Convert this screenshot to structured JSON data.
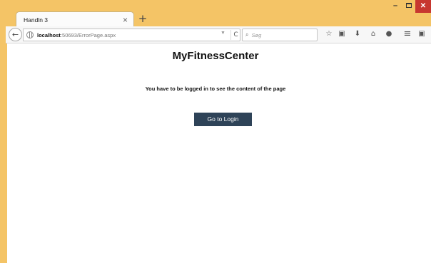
{
  "tab": {
    "title": "Handln 3",
    "close_glyph": "×",
    "new_tab_glyph": "+"
  },
  "window": {
    "minimize_glyph": "–",
    "close_glyph": "✕"
  },
  "toolbar": {
    "back_glyph": "←",
    "url_host": "localhost",
    "url_rest": ":50693/ErrorPage.aspx",
    "url_dropdown_glyph": "▼",
    "reload_glyph": "C",
    "search_placeholder": "Søg",
    "search_glyph": "⌕",
    "icons": [
      {
        "name": "bookmark-star-icon",
        "glyph": "☆"
      },
      {
        "name": "clipboard-icon",
        "glyph": "▣"
      },
      {
        "name": "download-icon",
        "glyph": "⬇"
      },
      {
        "name": "home-icon",
        "glyph": "⌂"
      },
      {
        "name": "chat-icon",
        "glyph": "●"
      },
      {
        "name": "menu-icon",
        "glyph": "≡"
      },
      {
        "name": "addon-icon",
        "glyph": "▣"
      }
    ]
  },
  "page": {
    "title": "MyFitnessCenter",
    "message": "You have to be logged in to see the content of the page",
    "login_button": "Go to Login"
  },
  "colors": {
    "accent_button": "#2e4358",
    "frame": "#f4c466",
    "close": "#c7372f"
  }
}
